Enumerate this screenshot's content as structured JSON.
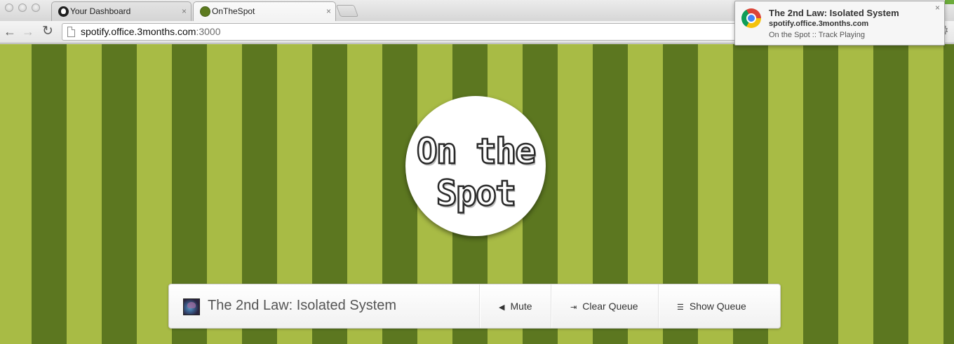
{
  "browser": {
    "tabs": [
      {
        "title": "Your Dashboard",
        "icon": "github-icon",
        "active": false
      },
      {
        "title": "OnTheSpot",
        "icon": "onthespot-favicon",
        "active": true
      }
    ],
    "close_glyph": "×",
    "address": {
      "host": "spotify.office.3months.com",
      "port": ":3000"
    }
  },
  "logo": {
    "line1": "On the",
    "line2": "Spot"
  },
  "player": {
    "track_title": "The 2nd Law: Isolated System",
    "buttons": {
      "mute": "Mute",
      "clear_queue": "Clear Queue",
      "show_queue": "Show Queue"
    }
  },
  "notification": {
    "title": "The 2nd Law: Isolated System",
    "url": "spotify.office.3months.com",
    "body": "On the Spot :: Track Playing",
    "close": "×"
  },
  "colors": {
    "stripe_light": "#a8bb45",
    "stripe_dark": "#5c7720"
  }
}
